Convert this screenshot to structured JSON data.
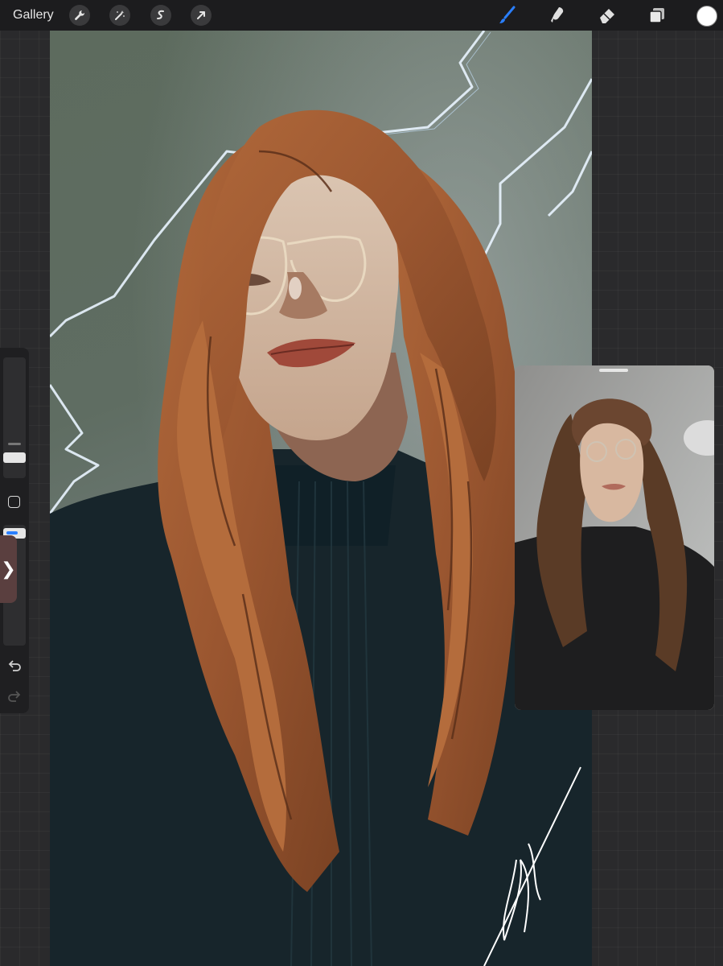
{
  "topbar": {
    "gallery_label": "Gallery",
    "left_tools": [
      "wrench-icon",
      "magic-wand-icon",
      "selection-icon",
      "transform-arrow-icon"
    ],
    "right_tools": [
      "brush-icon",
      "smudge-icon",
      "eraser-icon",
      "layers-icon"
    ],
    "active_tool": "brush-icon",
    "current_color": "#ffffff",
    "accent_color": "#2a7fff"
  },
  "sidebar": {
    "brush_size_level": 0.28,
    "opacity_level": 0.03,
    "collapse_glyph": "❯",
    "undo_icon": "undo-icon",
    "redo_icon": "redo-icon"
  },
  "canvas": {
    "background_color": "#5f6d62",
    "hair_color": "#9a5a33",
    "sweater_color": "#17252b"
  },
  "reference": {
    "window": "reference-image-window"
  }
}
